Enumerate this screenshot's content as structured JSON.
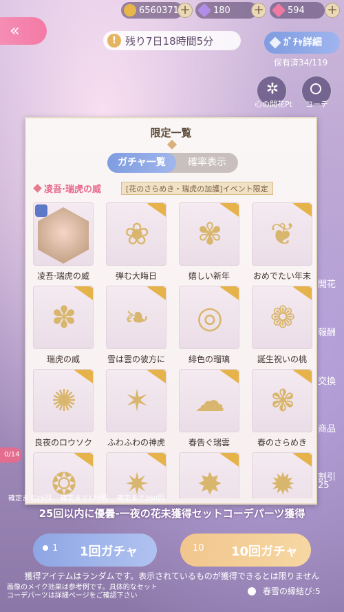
{
  "currencies": [
    {
      "name": "gold-coin",
      "value": "6560371"
    },
    {
      "name": "purple-diamond",
      "value": "180"
    },
    {
      "name": "pink-diamond",
      "value": "594"
    }
  ],
  "timer": {
    "text": "残り7日18時間5分"
  },
  "gacha_detail_label": "ｶﾞﾁｬ詳細",
  "owned": "保有済34/119",
  "right_buttons": {
    "heart_label": "心の開花Pt",
    "coord_label": "コーデ"
  },
  "modal": {
    "title": "限定一覧",
    "tabs": [
      "ガチャ一覧",
      "確率表示"
    ],
    "section_name": "凌吾·瑞虎の威",
    "event_tag": "[花のさらめき・瑞虎の加護]イベント限定",
    "items": [
      {
        "label": "凌吾·瑞虎の威",
        "glyph": "✿"
      },
      {
        "label": "弾む大晦日",
        "glyph": "❀"
      },
      {
        "label": "嬉しい新年",
        "glyph": "✾"
      },
      {
        "label": "おめでたい年末",
        "glyph": "❦"
      },
      {
        "label": "瑞虎の威",
        "glyph": "✽"
      },
      {
        "label": "雪は雲の彼方に",
        "glyph": "❧"
      },
      {
        "label": "緋色の瑠璃",
        "glyph": "◎"
      },
      {
        "label": "誕生祝いの桃",
        "glyph": "❁"
      },
      {
        "label": "良夜のロウソク",
        "glyph": "✺"
      },
      {
        "label": "ふわふわの神虎",
        "glyph": "✶"
      },
      {
        "label": "春告ぐ瑞雲",
        "glyph": "☁"
      },
      {
        "label": "春のさらめき",
        "glyph": "❃"
      },
      {
        "label": "",
        "glyph": "❂"
      },
      {
        "label": "",
        "glyph": "✷"
      },
      {
        "label": "",
        "glyph": "✸"
      },
      {
        "label": "",
        "glyph": "✹"
      }
    ]
  },
  "progress": [
    "確定まで25回",
    "確定まで170回",
    "確定まで260回"
  ],
  "pity_counter": "0/14",
  "bonus_text": "25回以内に優曇-一夜の花未獲得セットコーデパーツ獲得",
  "gacha1": {
    "count": "1",
    "label": "1回ガチャ"
  },
  "gacha10": {
    "count": "10",
    "label": "10回ガチャ"
  },
  "note_random": "獲得アイテムはランダムです。表示されているものが獲得できるとは限りません",
  "note_effect_1": "画像のメイク効果は参考例です。具体的なセット",
  "note_effect_2": "コーデパーツは詳細ページをご確認下さい",
  "ticket": "春雪の縁結び:5",
  "side_labels": [
    "開花",
    "報酬",
    "交換",
    "商品",
    "割引",
    "25"
  ]
}
